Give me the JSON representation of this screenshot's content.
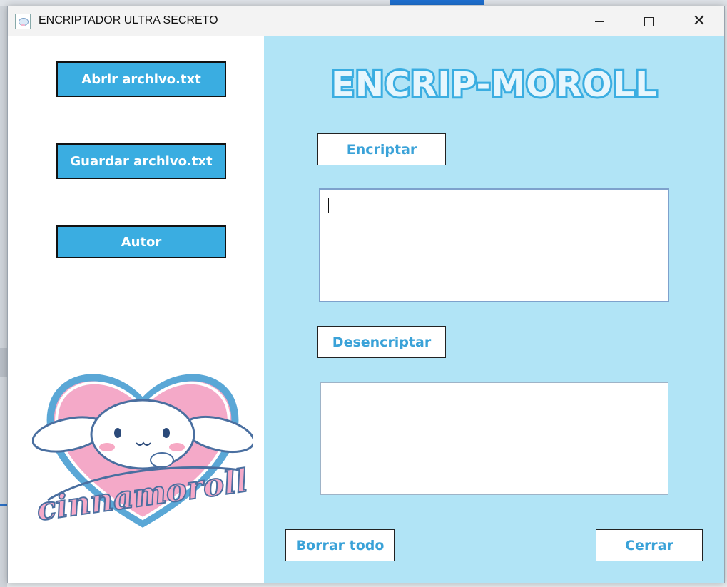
{
  "window": {
    "title": "ENCRIPTADOR ULTRA SECRETO",
    "controls": {
      "minimize": "minimize",
      "maximize": "maximize",
      "close": "close"
    }
  },
  "sidebar": {
    "open_label": "Abrir archivo.txt",
    "save_label": "Guardar archivo.txt",
    "author_label": "Autor",
    "mascot_text": "cinnamoroll"
  },
  "main": {
    "logo_text": "ENCRIP-MOROLL",
    "encrypt_label": "Encriptar",
    "decrypt_label": "Desencriptar",
    "encrypt_input_value": "",
    "decrypt_output_value": "",
    "clear_label": "Borrar todo",
    "close_label": "Cerrar"
  },
  "colors": {
    "panel_blue": "#b1e4f6",
    "button_blue": "#3aade1",
    "label_blue": "#3aa2d8",
    "heart_pink": "#f4a9c8"
  }
}
